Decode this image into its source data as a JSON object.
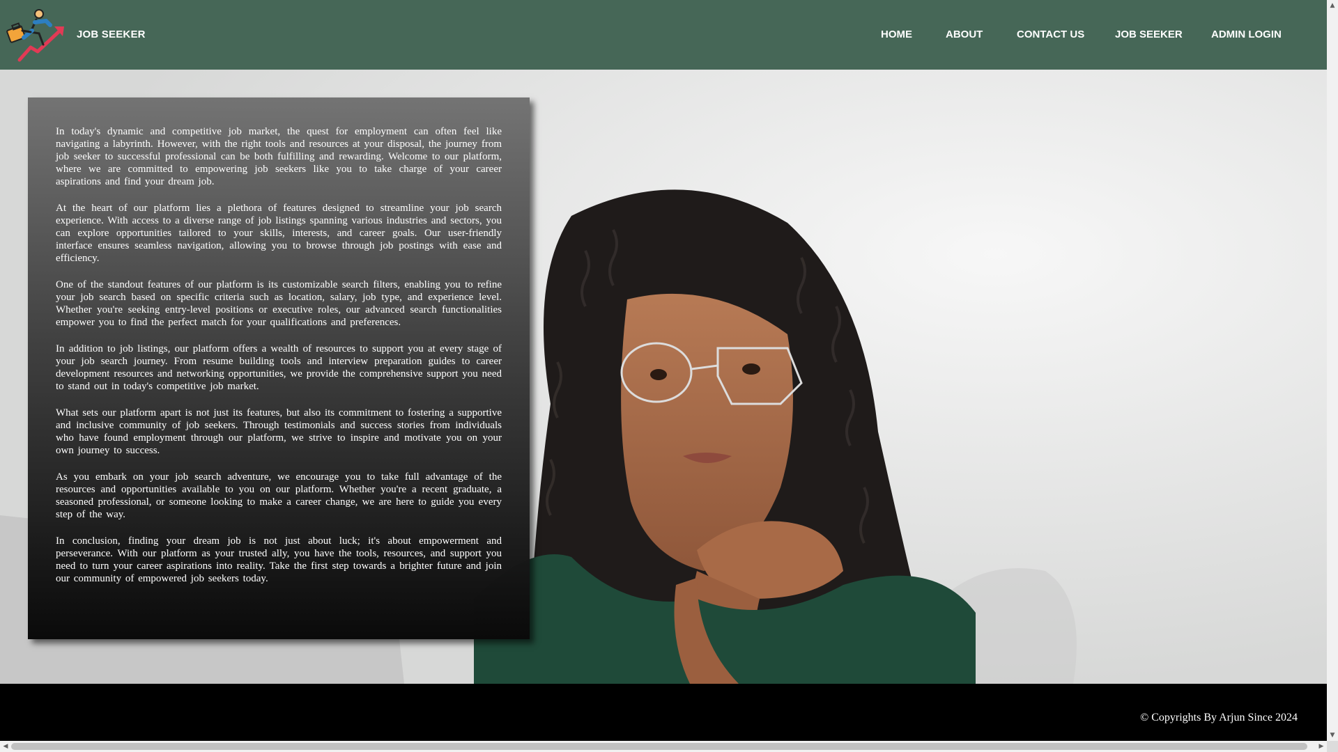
{
  "header": {
    "brand": "JOB SEEKER",
    "nav": {
      "home": "HOME",
      "about": "ABOUT",
      "contact": "CONTACT US",
      "job_seeker": "JOB SEEKER",
      "admin_login": "ADMIN LOGIN"
    },
    "icon": "job-seeker-logo-icon"
  },
  "content": {
    "paragraphs": [
      "In today's dynamic and competitive job market, the quest for employment can often feel like navigating a labyrinth. However, with the right tools and resources at your disposal, the journey from job seeker to successful professional can be both fulfilling and rewarding. Welcome to our platform, where we are committed to empowering job seekers like you to take charge of your career aspirations and find your dream job.",
      "At the heart of our platform lies a plethora of features designed to streamline your job search experience. With access to a diverse range of job listings spanning various industries and sectors, you can explore opportunities tailored to your skills, interests, and career goals. Our user-friendly interface ensures seamless navigation, allowing you to browse through job postings with ease and efficiency.",
      "One of the standout features of our platform is its customizable search filters, enabling you to refine your job search based on specific criteria such as location, salary, job type, and experience level. Whether you're seeking entry-level positions or executive roles, our advanced search functionalities empower you to find the perfect match for your qualifications and preferences.",
      "In addition to job listings, our platform offers a wealth of resources to support you at every stage of your job search journey. From resume building tools and interview preparation guides to career development resources and networking opportunities, we provide the comprehensive support you need to stand out in today's competitive job market.",
      "What sets our platform apart is not just its features, but also its commitment to fostering a supportive and inclusive community of job seekers. Through testimonials and success stories from individuals who have found employment through our platform, we strive to inspire and motivate you on your own journey to success.",
      "As you embark on your job search adventure, we encourage you to take full advantage of the resources and opportunities available to you on our platform. Whether you're a recent graduate, a seasoned professional, or someone looking to make a career change, we are here to guide you every step of the way.",
      "In conclusion, finding your dream job is not just about luck; it's about empowerment and perseverance. With our platform as your trusted ally, you have the tools, resources, and support you need to turn your career aspirations into reality. Take the first step towards a brighter future and join our community of empowered job seekers today."
    ]
  },
  "footer": {
    "copyright": "© Copyrights By Arjun Since 2024"
  },
  "colors": {
    "navbar": "#466757",
    "footer": "#000000",
    "text": "#ffffff"
  }
}
